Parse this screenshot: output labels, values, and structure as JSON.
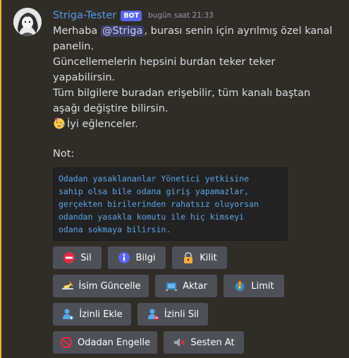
{
  "message": {
    "username": "Striga-Tester",
    "bot_tag": "BOT",
    "timestamp": "bugün saat 21:33",
    "lines": {
      "l1_pre": "Merhaba ",
      "l1_mention": "@Striga",
      "l1_post": ", burası senin için ayrılmış özel kanal",
      "l2": "panelin.",
      "l3": "Güncellemelerin hepsini burdan teker teker",
      "l4": "yapabilirsin.",
      "l5": "Tüm bilgilere buradan erişebilir, tüm kanalı baştan",
      "l6": "aşağı değiştire bilirsin.",
      "l7": "İyi eğlenceler."
    },
    "party_emoji": "partying-face-emoji",
    "note_label": "Not:",
    "code_block": "Odadan yasaklananlar Yönetici yetkisine\nsahip olsa bile odana giriş yapamazlar,\ngerçekten birilerinden rahatsız oluyorsan\nodandan yasakla komutu ile hiç kimseyi\nodana sokmaya bilirsin."
  },
  "buttons": {
    "delete": {
      "label": "Sil",
      "icon": "no-entry-icon"
    },
    "info": {
      "label": "Bilgi",
      "icon": "info-icon"
    },
    "lock": {
      "label": "Kilit",
      "icon": "lock-icon"
    },
    "rename": {
      "label": "İsim Güncelle",
      "icon": "writing-hand-icon"
    },
    "transfer": {
      "label": "Aktar",
      "icon": "transfer-icon"
    },
    "limit": {
      "label": "Limit",
      "icon": "limit-icon"
    },
    "add_permission": {
      "label": "İzinli Ekle",
      "icon": "user-add-icon"
    },
    "remove_permission": {
      "label": "İzinli Sil",
      "icon": "user-remove-icon"
    },
    "ban": {
      "label": "Odadan Engelle",
      "icon": "ban-icon"
    },
    "kick_voice": {
      "label": "Sesten At",
      "icon": "mute-icon"
    }
  },
  "colors": {
    "username": "#4e9cf3",
    "bot_tag": "#5865f2",
    "code_text": "#5aa7ea",
    "button_bg": "#4e5058",
    "mention_bar": "#f0b232"
  }
}
